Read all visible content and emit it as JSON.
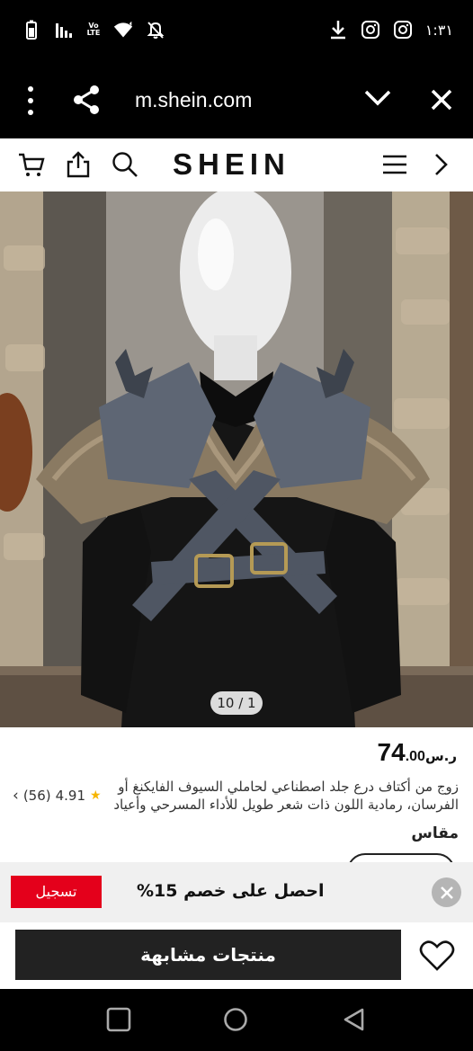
{
  "status_bar": {
    "time": "١:٣١",
    "icons": [
      "battery-icon",
      "signal-icon",
      "volte-icon",
      "wifi-icon",
      "mute-icon",
      "download-icon",
      "instagram-icon",
      "instagram-icon"
    ],
    "volte_label": "Vo LTE"
  },
  "browser": {
    "url": "m.shein.com",
    "icons": [
      "more-vert-icon",
      "share-icon",
      "chevron-down-icon",
      "close-icon"
    ]
  },
  "header": {
    "logo": "SHEIN",
    "icons": [
      "cart-icon",
      "share-icon",
      "search-icon",
      "menu-icon",
      "chevron-right-icon"
    ]
  },
  "gallery": {
    "counter": "10 / 1"
  },
  "product": {
    "currency": "ر.س",
    "price_int": "74",
    "price_dec": ".00",
    "title": "زوج من أكتاف درع جلد اصطناعي لحاملي السيوف الفايكنغ أو الفرسان، رمادية اللون ذات شعر طويل للأداء المسرحي وأعياد",
    "rating": "4.91",
    "reviews": "(56)",
    "size_label": "مقاس"
  },
  "promo": {
    "register_label": "تسجيل",
    "text": "احصل على خصم 15%"
  },
  "actions": {
    "similar_label": "منتجات مشابهة"
  },
  "colors": {
    "accent_red": "#e4001b",
    "star": "#f6b500",
    "dark_button": "#222222"
  }
}
